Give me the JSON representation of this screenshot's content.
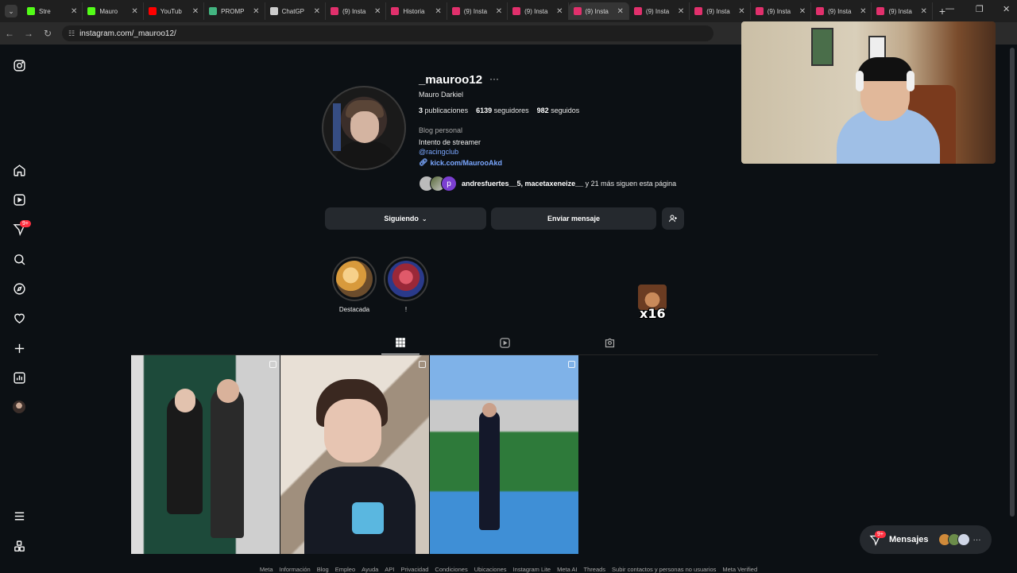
{
  "browser": {
    "tabs": [
      {
        "label": "Stre",
        "fav": "#53fc18",
        "active": false
      },
      {
        "label": "Mauro",
        "fav": "#53fc18",
        "active": false
      },
      {
        "label": "YouTub",
        "fav": "#ff0000",
        "active": false
      },
      {
        "label": "PROMP",
        "fav": "#43b581",
        "active": false
      },
      {
        "label": "ChatGP",
        "fav": "#cccccc",
        "active": false
      },
      {
        "label": "(9) Insta",
        "fav": "#e1306c",
        "active": false
      },
      {
        "label": "Historia",
        "fav": "#e1306c",
        "active": false
      },
      {
        "label": "(9) Insta",
        "fav": "#e1306c",
        "active": false
      },
      {
        "label": "(9) Insta",
        "fav": "#e1306c",
        "active": false
      },
      {
        "label": "(9) Insta",
        "fav": "#e1306c",
        "active": true
      },
      {
        "label": "(9) Insta",
        "fav": "#e1306c",
        "active": false
      },
      {
        "label": "(9) Insta",
        "fav": "#e1306c",
        "active": false
      },
      {
        "label": "(9) Insta",
        "fav": "#e1306c",
        "active": false
      },
      {
        "label": "(9) Insta",
        "fav": "#e1306c",
        "active": false
      },
      {
        "label": "(9) Insta",
        "fav": "#e1306c",
        "active": false
      }
    ],
    "url": "instagram.com/_mauroo12/"
  },
  "nav": {
    "icons": [
      "instagram-icon",
      "home-icon",
      "reels-icon",
      "messages-icon",
      "search-icon",
      "explore-icon",
      "notifications-icon",
      "create-icon",
      "dashboard-icon",
      "profile-icon",
      "more-icon",
      "meta-apps-icon"
    ],
    "notif_badge": "9+"
  },
  "profile": {
    "username": "_mauroo12",
    "more": "···",
    "full_name": "Mauro Darkiel",
    "posts_count": "3",
    "posts_label": "publicaciones",
    "followers_count": "6139",
    "followers_label": "seguidores",
    "following_count": "982",
    "following_label": "seguidos",
    "category": "Blog personal",
    "bio": "Intento de streamer",
    "link1": "@racingclub",
    "link2": "kick.com/MaurooAkd",
    "followed_by_names": "andresfuertes__5, macetaxeneize__",
    "followed_by_rest": " y 21 más siguen esta página",
    "followed_avatar_letter": "p"
  },
  "actions": {
    "following_label": "Siguiendo",
    "message_label": "Enviar mensaje"
  },
  "highlights": [
    {
      "label": "Destacada"
    },
    {
      "label": "!"
    }
  ],
  "emote": {
    "count": "x16"
  },
  "messages": {
    "label": "Mensajes",
    "badge": "9+"
  },
  "footer": [
    "Meta",
    "Información",
    "Blog",
    "Empleo",
    "Ayuda",
    "API",
    "Privacidad",
    "Condiciones",
    "Ubicaciones",
    "Instagram Lite",
    "Meta AI",
    "Threads",
    "Subir contactos y personas no usuarios",
    "Meta Verified"
  ]
}
